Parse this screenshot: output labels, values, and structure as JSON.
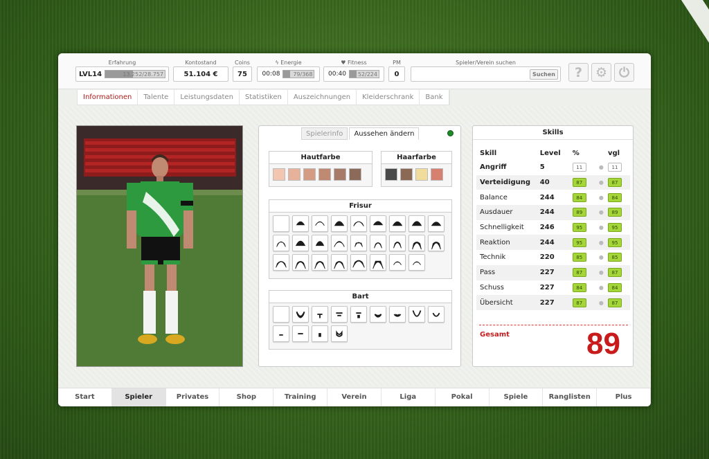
{
  "header": {
    "erfahrung": {
      "label": "Erfahrung",
      "level": "LVL14",
      "progress": "13.252/28.757",
      "fill": 0.46
    },
    "kontostand": {
      "label": "Kontostand",
      "value": "51.104 €"
    },
    "coins": {
      "label": "Coins",
      "value": "75"
    },
    "energie": {
      "label": "Energie",
      "timer": "00:08",
      "progress": "79/368",
      "fill": 0.21
    },
    "fitness": {
      "label": "Fitness",
      "timer": "00:40",
      "progress": "52/224",
      "fill": 0.23
    },
    "pm": {
      "label": "PM",
      "value": "0"
    },
    "search": {
      "label": "Spieler/Verein suchen",
      "button": "Suchen"
    },
    "icons": {
      "help": "?",
      "settings": "⚙",
      "power": "⏻"
    }
  },
  "subnav": [
    "Informationen",
    "Talente",
    "Leistungsdaten",
    "Statistiken",
    "Auszeichnungen",
    "Kleiderschrank",
    "Bank"
  ],
  "appearance": {
    "tabs": [
      "Spielerinfo",
      "Aussehen ändern"
    ],
    "hautfarbe": {
      "title": "Hautfarbe",
      "colors": [
        "#f3c6b2",
        "#e6b29a",
        "#d49d83",
        "#c08a72",
        "#a87a68",
        "#8c6a59"
      ]
    },
    "haarfarbe": {
      "title": "Haarfarbe",
      "colors": [
        "#4a4a4a",
        "#8a6a55",
        "#f2dc9c",
        "#d88070"
      ]
    },
    "frisur": {
      "title": "Frisur"
    },
    "bart": {
      "title": "Bart"
    }
  },
  "skills": {
    "title": "Skills",
    "headers": [
      "Skill",
      "Level",
      "%",
      "vgl"
    ],
    "rows": [
      {
        "name": "Angriff",
        "level": "5",
        "pct": "11",
        "vgl": "11",
        "bold": true,
        "plain": true
      },
      {
        "name": "Verteidigung",
        "level": "40",
        "pct": "87",
        "vgl": "87",
        "bold": true
      },
      {
        "name": "Balance",
        "level": "244",
        "pct": "84",
        "vgl": "84"
      },
      {
        "name": "Ausdauer",
        "level": "244",
        "pct": "89",
        "vgl": "89"
      },
      {
        "name": "Schnelligkeit",
        "level": "246",
        "pct": "95",
        "vgl": "95"
      },
      {
        "name": "Reaktion",
        "level": "244",
        "pct": "95",
        "vgl": "95"
      },
      {
        "name": "Technik",
        "level": "220",
        "pct": "85",
        "vgl": "85"
      },
      {
        "name": "Pass",
        "level": "227",
        "pct": "87",
        "vgl": "87"
      },
      {
        "name": "Schuss",
        "level": "227",
        "pct": "84",
        "vgl": "84"
      },
      {
        "name": "Übersicht",
        "level": "227",
        "pct": "87",
        "vgl": "87"
      }
    ],
    "gesamt_label": "Gesamt",
    "gesamt_value": "89"
  },
  "bottomnav": [
    "Start",
    "Spieler",
    "Privates",
    "Shop",
    "Training",
    "Verein",
    "Liga",
    "Pokal",
    "Spiele",
    "Ranglisten",
    "Plus"
  ],
  "bottomnav_active": 1
}
